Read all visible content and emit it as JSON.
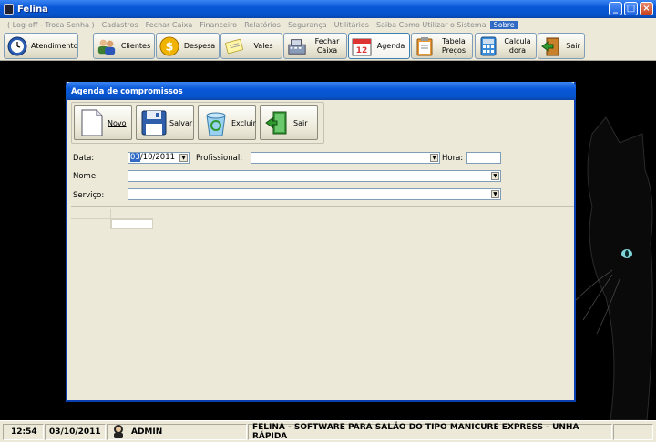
{
  "window": {
    "title": "Felina"
  },
  "menu": {
    "items": [
      "( Log-off - Troca Senha )",
      "Cadastros",
      "Fechar Caixa",
      "Financeiro",
      "Relatórios",
      "Segurança",
      "Utilitários",
      "Saiba Como Utilizar o Sistema",
      "Sobre"
    ],
    "active": "Sobre"
  },
  "toolbar": {
    "atendimento": "Atendimento",
    "clientes": "Clientes",
    "despesa": "Despesa",
    "vales": "Vales",
    "fechar_caixa_1": "Fechar",
    "fechar_caixa_2": "Caixa",
    "agenda": "Agenda",
    "agenda_day": "12",
    "tabela_1": "Tabela",
    "tabela_2": "Preços",
    "calc_1": "Calcula",
    "calc_2": "dora",
    "sair": "Sair"
  },
  "dialog": {
    "title": "Agenda de compromissos",
    "buttons": {
      "novo": "Novo",
      "salvar": "Salvar",
      "excluir": "Excluir",
      "sair": "Sair"
    },
    "form": {
      "data_label": "Data:",
      "data_selected": "03",
      "data_rest": "/10/2011",
      "profissional_label": "Profissional:",
      "profissional_value": "",
      "hora_label": "Hora:",
      "hora_value": "",
      "nome_label": "Nome:",
      "nome_value": "",
      "servico_label": "Serviço:",
      "servico_value": ""
    }
  },
  "status": {
    "time": "12:54",
    "date": "03/10/2011",
    "user": "ADMIN",
    "message": "FELINA  -  SOFTWARE PARA SALÃO DO TIPO MANICURE EXPRESS - UNHA RÁPIDA"
  },
  "colors": {
    "accent": "#316ac5",
    "titlebar": "#0a58d8",
    "face": "#ece9d8"
  }
}
